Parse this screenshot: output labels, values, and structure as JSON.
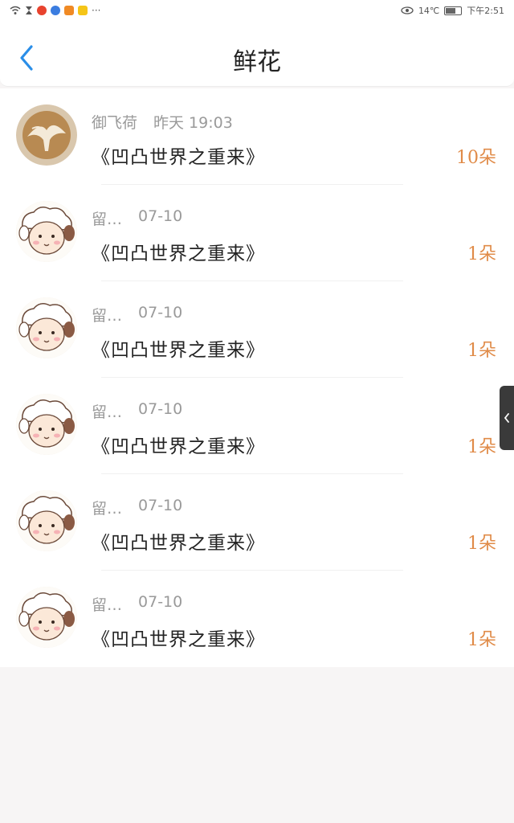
{
  "status": {
    "temp": "14℃",
    "time": "下午2:51",
    "more": "···"
  },
  "header": {
    "title": "鲜花"
  },
  "items": [
    {
      "user": "御飞荷",
      "date": "昨天 19:03",
      "work": "《凹凸世界之重来》",
      "count": "10朵",
      "avatar": "eagle-avatar"
    },
    {
      "user": "留…",
      "date": "07-10",
      "work": "《凹凸世界之重来》",
      "count": "1朵",
      "avatar": "sheep-avatar"
    },
    {
      "user": "留…",
      "date": "07-10",
      "work": "《凹凸世界之重来》",
      "count": "1朵",
      "avatar": "sheep-avatar"
    },
    {
      "user": "留…",
      "date": "07-10",
      "work": "《凹凸世界之重来》",
      "count": "1朵",
      "avatar": "sheep-avatar"
    },
    {
      "user": "留…",
      "date": "07-10",
      "work": "《凹凸世界之重来》",
      "count": "1朵",
      "avatar": "sheep-avatar"
    },
    {
      "user": "留…",
      "date": "07-10",
      "work": "《凹凸世界之重来》",
      "count": "1朵",
      "avatar": "sheep-avatar"
    }
  ],
  "colors": {
    "accent_blue": "#2a8ee8",
    "count_orange": "#e08b48"
  }
}
